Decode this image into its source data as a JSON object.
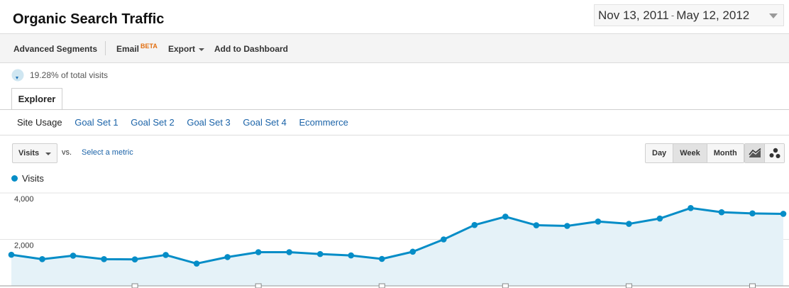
{
  "page": {
    "title": "Organic Search Traffic",
    "date_start": "Nov 13, 2011",
    "date_separator": "-",
    "date_end": "May 12, 2012"
  },
  "toolbar": {
    "advanced_segments": "Advanced Segments",
    "email": "Email",
    "beta": "BETA",
    "export": "Export",
    "add_to_dashboard": "Add to Dashboard"
  },
  "summary": {
    "percent_text": "19.28% of total visits",
    "pie_icon": "pie-chart-icon"
  },
  "tabs": {
    "explorer": "Explorer"
  },
  "subtabs": {
    "site_usage": "Site Usage",
    "goal_set_1": "Goal Set 1",
    "goal_set_2": "Goal Set 2",
    "goal_set_3": "Goal Set 3",
    "goal_set_4": "Goal Set 4",
    "ecommerce": "Ecommerce"
  },
  "controls": {
    "metric": "Visits",
    "vs": "vs.",
    "select_metric": "Select a metric",
    "day": "Day",
    "week": "Week",
    "month": "Month",
    "line_icon": "line-chart-icon",
    "motion_icon": "motion-chart-icon"
  },
  "colors": {
    "series": "#058dc7",
    "fill": "#e5f2f8",
    "link": "#1b63a8"
  },
  "chart_data": {
    "type": "area",
    "series": [
      {
        "name": "Visits",
        "values": [
          1340,
          1150,
          1300,
          1150,
          1140,
          1330,
          960,
          1240,
          1450,
          1450,
          1370,
          1310,
          1160,
          1470,
          2000,
          2620,
          2980,
          2610,
          2580,
          2770,
          2670,
          2900,
          3350,
          3170,
          3120,
          3100
        ]
      }
    ],
    "y_ticks": [
      "4,000",
      "2,000"
    ],
    "y_tick_values": [
      4000,
      2000
    ],
    "ylim": [
      0,
      4000
    ],
    "grid": true
  }
}
